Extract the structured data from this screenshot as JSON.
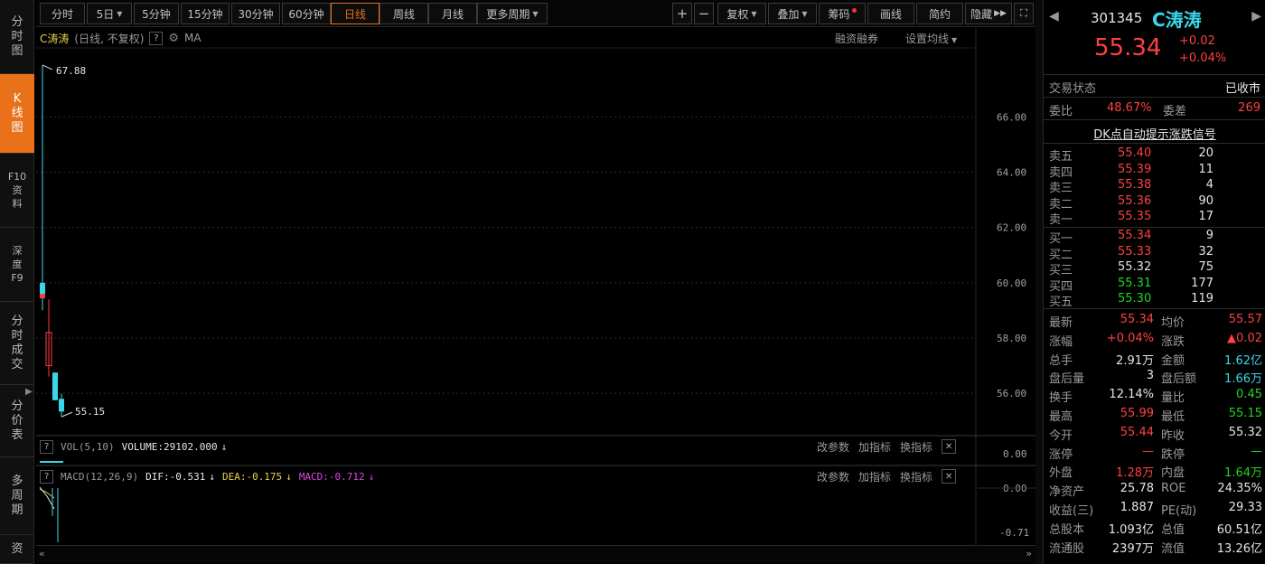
{
  "left_nav": [
    {
      "label": "分时图",
      "chars": [
        "分",
        "时",
        "图"
      ],
      "active": false
    },
    {
      "label": "K线图",
      "chars": [
        "K",
        "线",
        "图"
      ],
      "active": true
    },
    {
      "label": "F10资料",
      "chars": [
        "F10",
        "资",
        "料"
      ],
      "active": false
    },
    {
      "label": "深度F9",
      "chars": [
        "深",
        "度",
        "F9"
      ],
      "active": false
    },
    {
      "label": "分时成交",
      "chars": [
        "分",
        "时",
        "成",
        "交"
      ],
      "active": false
    },
    {
      "label": "分价表",
      "chars": [
        "分",
        "价",
        "表"
      ],
      "active": false
    },
    {
      "label": "多周期",
      "chars": [
        "多",
        "周",
        "期"
      ],
      "active": false
    },
    {
      "label": "资",
      "chars": [
        "资"
      ],
      "active": false
    }
  ],
  "toolbar": {
    "periods": [
      "分时",
      "5日",
      "5分钟",
      "15分钟",
      "30分钟",
      "60分钟",
      "日线",
      "周线",
      "月线",
      "更多周期"
    ],
    "active_period": "日线",
    "right_buttons": [
      "+",
      "−",
      "复权",
      "叠加",
      "筹码",
      "画线",
      "简约",
      "隐藏"
    ]
  },
  "chart": {
    "title_stock": "C涛涛",
    "title_meta": "(日线, 不复权)",
    "ma_label": "MA",
    "margin_label": "融资融券",
    "ma_settings": "设置均线",
    "high_label": "67.88",
    "low_label": "55.15",
    "price_axis": [
      "66.00",
      "64.00",
      "62.00",
      "60.00",
      "58.00",
      "56.00"
    ],
    "vol_line": {
      "name": "VOL(5,10)",
      "value": "VOLUME:29102.000",
      "axis": "0.00"
    },
    "macd_line": {
      "name": "MACD(12,26,9)",
      "dif": "DIF:-0.531",
      "dea": "DEA:-0.175",
      "macd": "MACD:-0.712",
      "axis_top": "0.00",
      "axis_bottom": "-0.71"
    },
    "panel_buttons": [
      "改参数",
      "加指标",
      "换指标"
    ]
  },
  "chart_data": {
    "type": "candlestick",
    "price_range": [
      54.5,
      68.5
    ],
    "candles": [
      {
        "open": 59.5,
        "high": 67.88,
        "low": 59.0,
        "close": 60.0,
        "color": "cyan"
      },
      {
        "open": 57.0,
        "high": 59.4,
        "low": 56.6,
        "close": 58.2,
        "color": "red"
      },
      {
        "open": 56.75,
        "high": 56.75,
        "low": 55.75,
        "close": 55.75,
        "color": "cyan"
      },
      {
        "open": 55.8,
        "high": 55.99,
        "low": 55.15,
        "close": 55.34,
        "color": "cyan"
      }
    ]
  },
  "quote": {
    "code": "301345",
    "name": "C涛涛",
    "price": "55.34",
    "change": "+0.02",
    "change_pct": "+0.04%",
    "trade_status_label": "交易状态",
    "trade_status": "已收市",
    "weibi_label": "委比",
    "weibi": "48.67%",
    "weicha_label": "委差",
    "weicha": "269",
    "signal_link": "DK点自动提示涨跌信号",
    "sells": [
      {
        "label": "卖五",
        "price": "55.40",
        "vol": "20"
      },
      {
        "label": "卖四",
        "price": "55.39",
        "vol": "11"
      },
      {
        "label": "卖三",
        "price": "55.38",
        "vol": "4"
      },
      {
        "label": "卖二",
        "price": "55.36",
        "vol": "90"
      },
      {
        "label": "卖一",
        "price": "55.35",
        "vol": "17"
      }
    ],
    "buys": [
      {
        "label": "买一",
        "price": "55.34",
        "vol": "9"
      },
      {
        "label": "买二",
        "price": "55.33",
        "vol": "32"
      },
      {
        "label": "买三",
        "price": "55.32",
        "vol": "75"
      },
      {
        "label": "买四",
        "price": "55.31",
        "vol": "177"
      },
      {
        "label": "买五",
        "price": "55.30",
        "vol": "119"
      }
    ],
    "stats": [
      {
        "l1": "最新",
        "v1": "55.34",
        "c1": "red",
        "l2": "均价",
        "v2": "55.57",
        "c2": "red"
      },
      {
        "l1": "涨幅",
        "v1": "+0.04%",
        "c1": "red",
        "l2": "涨跌",
        "v2": "▲0.02",
        "c2": "red"
      },
      {
        "l1": "总手",
        "v1": "2.91万",
        "c1": "white",
        "l2": "金额",
        "v2": "1.62亿",
        "c2": "cyan"
      },
      {
        "l1": "盘后量",
        "v1": "3",
        "c1": "white",
        "l2": "盘后额",
        "v2": "1.66万",
        "c2": "cyan"
      },
      {
        "l1": "换手",
        "v1": "12.14%",
        "c1": "white",
        "l2": "量比",
        "v2": "0.45",
        "c2": "green"
      },
      {
        "l1": "最高",
        "v1": "55.99",
        "c1": "red",
        "l2": "最低",
        "v2": "55.15",
        "c2": "green"
      },
      {
        "l1": "今开",
        "v1": "55.44",
        "c1": "red",
        "l2": "昨收",
        "v2": "55.32",
        "c2": "white"
      },
      {
        "l1": "涨停",
        "v1": "—",
        "c1": "red",
        "l2": "跌停",
        "v2": "—",
        "c2": "green"
      },
      {
        "l1": "外盘",
        "v1": "1.28万",
        "c1": "red",
        "l2": "内盘",
        "v2": "1.64万",
        "c2": "green"
      },
      {
        "l1": "净资产",
        "v1": "25.78",
        "c1": "white",
        "l2": "ROE",
        "v2": "24.35%",
        "c2": "white"
      },
      {
        "l1": "收益(三)",
        "v1": "1.887",
        "c1": "white",
        "l2": "PE(动)",
        "v2": "29.33",
        "c2": "white"
      },
      {
        "l1": "总股本",
        "v1": "1.093亿",
        "c1": "white",
        "l2": "总值",
        "v2": "60.51亿",
        "c2": "white"
      },
      {
        "l1": "流通股",
        "v1": "2397万",
        "c1": "white",
        "l2": "流值",
        "v2": "13.26亿",
        "c2": "white"
      }
    ]
  },
  "colors": {
    "accent": "#e8711a",
    "up": "#ff4040",
    "down": "#3ad7ec",
    "green": "#22d322"
  }
}
